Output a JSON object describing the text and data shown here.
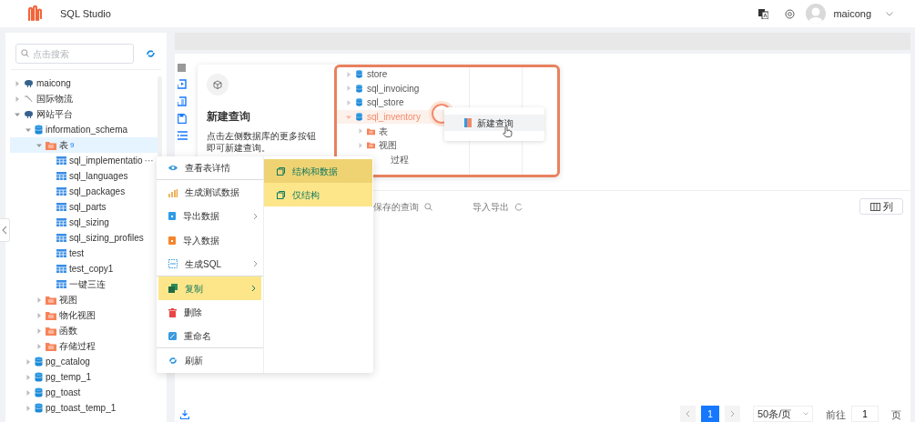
{
  "header": {
    "title": "SQL Studio",
    "user": "maicong"
  },
  "sidebar": {
    "search": {
      "placeholder": "点击搜索"
    },
    "tree": [
      {
        "label": "maicong",
        "kind": "pg",
        "expanded": false,
        "selected": false
      },
      {
        "label": "国际物流",
        "kind": "mysql",
        "expanded": false,
        "selected": false
      },
      {
        "label": "网站平台",
        "kind": "pg",
        "expanded": true,
        "selected": false,
        "children": [
          {
            "label": "information_schema",
            "kind": "schema",
            "expanded": true,
            "selected": false,
            "children": [
              {
                "label": "表",
                "badge": "9",
                "kind": "folder",
                "expanded": true,
                "selected": true,
                "children": [
                  {
                    "label": "sql_implementatio",
                    "more": "···",
                    "kind": "table",
                    "selected": false
                  },
                  {
                    "label": "sql_languages",
                    "kind": "table",
                    "selected": false
                  },
                  {
                    "label": "sql_packages",
                    "kind": "table",
                    "selected": false
                  },
                  {
                    "label": "sql_parts",
                    "kind": "table",
                    "selected": false
                  },
                  {
                    "label": "sql_sizing",
                    "kind": "table",
                    "selected": false
                  },
                  {
                    "label": "sql_sizing_profiles",
                    "kind": "table",
                    "selected": false
                  },
                  {
                    "label": "test",
                    "kind": "table",
                    "selected": false
                  },
                  {
                    "label": "test_copy1",
                    "kind": "table",
                    "selected": false
                  },
                  {
                    "label": "一键三连",
                    "kind": "table",
                    "selected": false
                  }
                ]
              },
              {
                "label": "视图",
                "kind": "folder",
                "expanded": false,
                "selected": false
              },
              {
                "label": "物化视图",
                "kind": "folder",
                "expanded": false,
                "selected": false
              },
              {
                "label": "函数",
                "kind": "folder",
                "expanded": false,
                "selected": false
              },
              {
                "label": "存储过程",
                "kind": "folder",
                "expanded": false,
                "selected": false
              }
            ]
          },
          {
            "label": "pg_catalog",
            "kind": "schema",
            "expanded": false,
            "selected": false
          },
          {
            "label": "pg_temp_1",
            "kind": "schema",
            "expanded": false,
            "selected": false
          },
          {
            "label": "pg_toast",
            "kind": "schema",
            "expanded": false,
            "selected": false
          },
          {
            "label": "pg_toast_temp_1",
            "kind": "schema",
            "expanded": false,
            "selected": false
          }
        ]
      }
    ]
  },
  "guide": {
    "title": "新建查询",
    "description": "点击左侧数据库的更多按钮即可新建查询。",
    "tutorial": {
      "tree": [
        {
          "label": "store",
          "kind": "schema",
          "expanded": false,
          "selected": false
        },
        {
          "label": "sql_invoicing",
          "kind": "schema",
          "expanded": false,
          "selected": false
        },
        {
          "label": "sql_store",
          "kind": "schema",
          "expanded": false,
          "selected": false
        },
        {
          "label": "sql_inventory",
          "kind": "schema",
          "expanded": true,
          "selected": true,
          "children": [
            {
              "label": "表",
              "kind": "folder",
              "expanded": false,
              "selected": false
            },
            {
              "label": "视图",
              "kind": "folder",
              "expanded": false,
              "selected": false
            },
            {
              "label": "过程",
              "kind": "folder",
              "selected": false
            }
          ]
        }
      ],
      "popup": "新建查询"
    }
  },
  "toolbar": {
    "saved_queries": "保存的查询",
    "import_export": "导入导出",
    "columns_button": "列"
  },
  "context_menu": {
    "items": [
      {
        "label": "查看表详情",
        "kind": "view",
        "submenu": false,
        "selected": false,
        "divider": true
      },
      {
        "label": "生成测试数据",
        "kind": "generate",
        "submenu": false,
        "selected": false,
        "divider": false
      },
      {
        "label": "导出数据",
        "kind": "export",
        "submenu": true,
        "selected": false,
        "divider": false
      },
      {
        "label": "导入数据",
        "kind": "import",
        "submenu": false,
        "selected": false,
        "divider": false
      },
      {
        "label": "生成SQL",
        "kind": "sql",
        "submenu": true,
        "selected": false,
        "divider": true
      },
      {
        "label": "复制",
        "kind": "copy",
        "submenu": true,
        "selected": true,
        "divider": false
      },
      {
        "label": "删除",
        "kind": "delete",
        "submenu": false,
        "selected": false,
        "divider": false
      },
      {
        "label": "重命名",
        "kind": "rename",
        "submenu": false,
        "selected": false,
        "divider": true
      },
      {
        "label": "刷新",
        "kind": "refresh",
        "submenu": false,
        "selected": false,
        "divider": false
      }
    ],
    "submenu": [
      {
        "label": "结构和数据",
        "selected": true
      },
      {
        "label": "仅结构",
        "selected": false
      }
    ]
  },
  "pagination": {
    "pages": [
      {
        "label": "1",
        "selected": true
      }
    ],
    "page_size": "50条/页",
    "goto_label": "前往",
    "goto_value": "1",
    "page_suffix": "页"
  }
}
